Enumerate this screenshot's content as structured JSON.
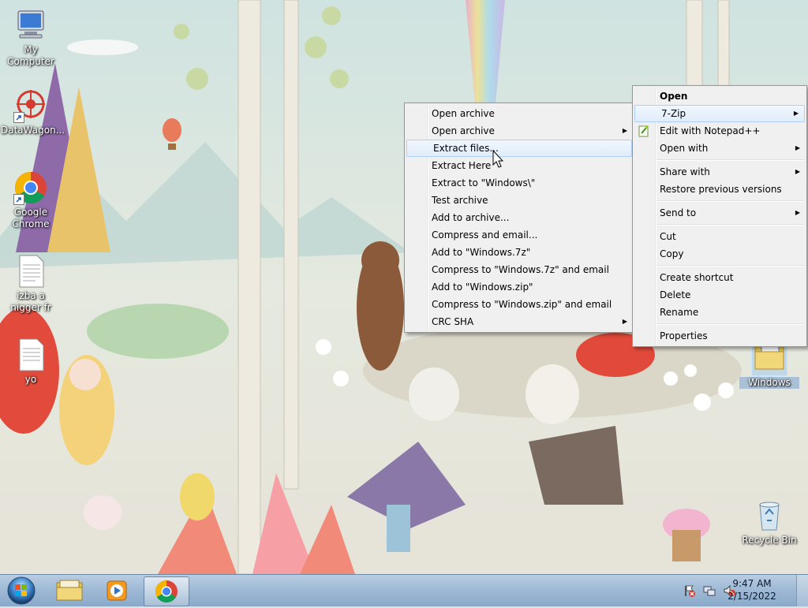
{
  "desktop": {
    "icons": [
      {
        "label": "My Computer",
        "icon": "computer-icon"
      },
      {
        "label": "DataWagon...",
        "icon": "datawagon-icon"
      },
      {
        "label": "Google Chrome",
        "icon": "chrome-icon"
      },
      {
        "label": "izba a nigger fr",
        "icon": "text-file-icon"
      },
      {
        "label": "yo",
        "icon": "text-file-icon"
      },
      {
        "label": "Windows",
        "icon": "folder-icon"
      },
      {
        "label": "Recycle Bin",
        "icon": "recycle-bin-icon"
      }
    ]
  },
  "context_menu": {
    "items": [
      {
        "label": "Open",
        "bold": true
      },
      {
        "label": "7-Zip",
        "submenu": true,
        "highlighted": true
      },
      {
        "label": "Edit with Notepad++",
        "icon": "notepadpp-icon"
      },
      {
        "label": "Open with",
        "submenu": true
      },
      {
        "label": "Share with",
        "submenu": true
      },
      {
        "label": "Restore previous versions"
      },
      {
        "label": "Send to",
        "submenu": true
      },
      {
        "label": "Cut"
      },
      {
        "label": "Copy"
      },
      {
        "label": "Create shortcut"
      },
      {
        "label": "Delete"
      },
      {
        "label": "Rename"
      },
      {
        "label": "Properties"
      }
    ]
  },
  "zip_submenu": {
    "items": [
      {
        "label": "Open archive"
      },
      {
        "label": "Open archive",
        "submenu": true
      },
      {
        "label": "Extract files...",
        "highlighted": true
      },
      {
        "label": "Extract Here"
      },
      {
        "label": "Extract to \"Windows\\\""
      },
      {
        "label": "Test archive"
      },
      {
        "label": "Add to archive..."
      },
      {
        "label": "Compress and email..."
      },
      {
        "label": "Add to \"Windows.7z\""
      },
      {
        "label": "Compress to \"Windows.7z\" and email"
      },
      {
        "label": "Add to \"Windows.zip\""
      },
      {
        "label": "Compress to \"Windows.zip\" and email"
      },
      {
        "label": "CRC SHA",
        "submenu": true
      }
    ]
  },
  "taskbar": {
    "pinned": [
      "explorer-icon",
      "media-player-icon",
      "chrome-icon"
    ],
    "active": "chrome-icon",
    "tray_icons": [
      "action-center-flag-icon",
      "network-icon",
      "volume-muted-icon"
    ],
    "clock": {
      "time": "9:47 AM",
      "date": "2/15/2022"
    }
  },
  "colors": {
    "menu_bg": "#f0f0f0",
    "highlight_border": "#aecff7",
    "taskbar": "#9fbad6"
  }
}
